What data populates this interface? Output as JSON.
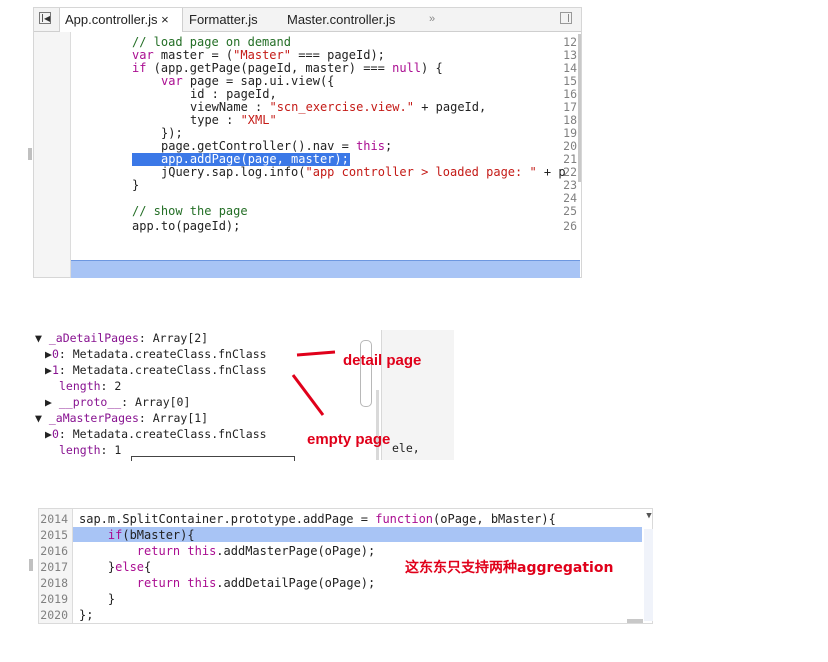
{
  "panel1": {
    "tabs": [
      "App.controller.js ×",
      "Formatter.js",
      "Master.controller.js",
      "»"
    ],
    "lines": [
      {
        "num": "12",
        "text": "// load page on demand"
      },
      {
        "num": "13",
        "text": "var master = (\"Master\" === pageId);"
      },
      {
        "num": "14",
        "text": "if (app.getPage(pageId, master) === null) {"
      },
      {
        "num": "15",
        "text": "var page = sap.ui.view({"
      },
      {
        "num": "16",
        "text": "id : pageId,"
      },
      {
        "num": "17",
        "text": "viewName : \"scn_exercise.view.\" + pageId,"
      },
      {
        "num": "18",
        "text": "type : \"XML\""
      },
      {
        "num": "19",
        "text": "});"
      },
      {
        "num": "20",
        "text": "page.getController().nav = this;"
      },
      {
        "num": "21",
        "text": "app.addPage(page, master);"
      },
      {
        "num": "22",
        "text": "jQuery.sap.log.info(\"app controller > loaded page: \" + p"
      },
      {
        "num": "23",
        "text": "}"
      },
      {
        "num": "24",
        "text": ""
      },
      {
        "num": "25",
        "text": "// show the page"
      },
      {
        "num": "26",
        "text": "app.to(pageId);"
      }
    ]
  },
  "panel2": {
    "rows": [
      "▼ _aDetailPages: Array[2]",
      "  ▶0: Metadata.createClass.fnClass",
      "  ▶1: Metadata.createClass.fnClass",
      "    length: 2",
      "  ▶ __proto__: Array[0]",
      "▼ _aMasterPages: Array[1]",
      "  ▶0: Metadata.createClass.fnClass",
      "    length: 1"
    ],
    "annotation_detail": "detail page",
    "annotation_empty": "empty page",
    "trailing_text": "ele,"
  },
  "panel3": {
    "lines": [
      {
        "num": "2014",
        "text": "sap.m.SplitContainer.prototype.addPage = function(oPage, bMaster){"
      },
      {
        "num": "2015",
        "text": "    if(bMaster){"
      },
      {
        "num": "2016",
        "text": "        return this.addMasterPage(oPage);"
      },
      {
        "num": "2017",
        "text": "    }else{"
      },
      {
        "num": "2018",
        "text": "        return this.addDetailPage(oPage);"
      },
      {
        "num": "2019",
        "text": "    }"
      },
      {
        "num": "2020",
        "text": "};"
      }
    ],
    "annotation": "这东东只支持两种aggregation"
  },
  "colors": {
    "selection": "#3b78e7",
    "highlight_line": "#a8c4f5",
    "annotation": "#e0001a",
    "string": "#c41a16",
    "comment": "#236e25",
    "keyword": "#aa0d91"
  }
}
